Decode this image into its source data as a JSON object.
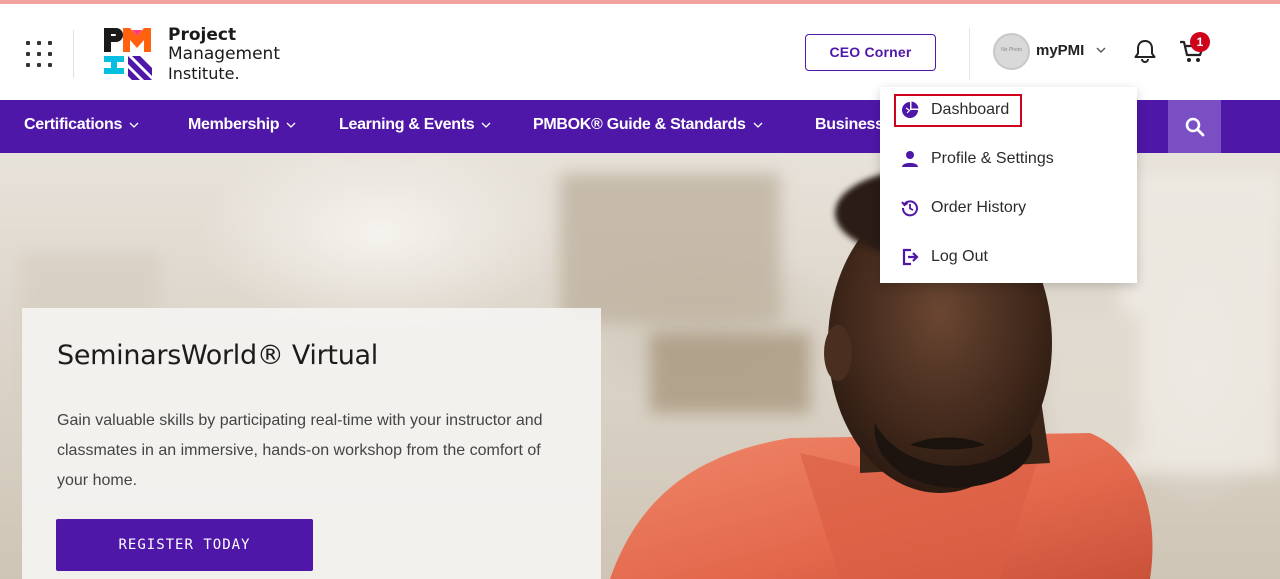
{
  "header": {
    "logo": {
      "line1": "Project",
      "line2": "Management",
      "line3": "Institute."
    },
    "ceo_button": "CEO Corner",
    "avatar_text": "No Photo",
    "account_label": "myPMI",
    "cart_count": "1"
  },
  "nav": {
    "items": [
      {
        "label": "Certifications"
      },
      {
        "label": "Membership"
      },
      {
        "label": "Learning & Events"
      },
      {
        "label": "PMBOK® Guide & Standards"
      },
      {
        "label": "Business"
      }
    ]
  },
  "dropdown": {
    "items": [
      {
        "label": "Dashboard",
        "icon": "dashboard-icon"
      },
      {
        "label": "Profile & Settings",
        "icon": "person-icon"
      },
      {
        "label": "Order History",
        "icon": "history-icon"
      },
      {
        "label": "Log Out",
        "icon": "logout-icon"
      }
    ]
  },
  "promo": {
    "title": "SeminarsWorld® Virtual",
    "description": "Gain valuable skills by participating real-time with your instructor and classmates in an immersive, hands-on workshop from the comfort of your home.",
    "cta": "REGISTER TODAY"
  },
  "colors": {
    "brand_purple": "#4f17a8",
    "highlight_red": "#d0021b",
    "badge_red": "#d0021b"
  }
}
